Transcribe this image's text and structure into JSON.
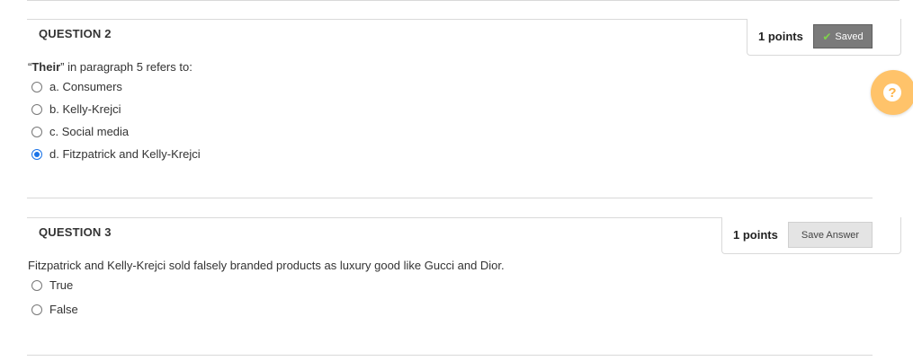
{
  "questions": [
    {
      "title": "QUESTION 2",
      "points": "1 points",
      "button_label": "Saved",
      "text_bold": "Their",
      "text_rest": "” in paragraph 5 refers to:",
      "text_open_quote": "“",
      "options": [
        "a. Consumers",
        "b. Kelly-Krejci",
        "c. Social media",
        "d. Fitzpatrick and Kelly-Krejci"
      ],
      "selected_index": 3
    },
    {
      "title": "QUESTION 3",
      "points": "1 points",
      "button_label": "Save Answer",
      "text": "Fitzpatrick and Kelly-Krejci sold falsely branded products as luxury good like Gucci and Dior.",
      "options": [
        "True",
        "False"
      ],
      "selected_index": null
    }
  ],
  "help_glyph": "?",
  "colors": {
    "selected_radio": "#1a73e8",
    "saved_button": "#7a7a7a",
    "save_button": "#e4e4e4",
    "help_button": "#ffc36a",
    "saved_check": "#7fd34a"
  },
  "icons": [
    "checkmark-icon",
    "help-icon"
  ]
}
